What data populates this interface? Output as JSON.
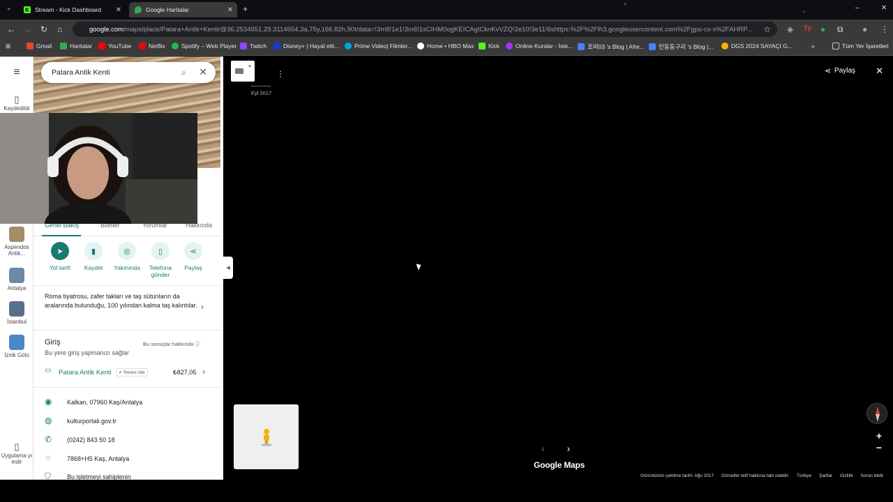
{
  "browser": {
    "tabs": [
      {
        "label": "Stream - Kick Dashboard",
        "icon": "kick-icon",
        "active": false
      },
      {
        "label": "Google Haritalar",
        "icon": "maps-pin-icon",
        "active": true
      }
    ],
    "url_host": "google.com",
    "url_rest": "/maps/place/Patara+Antik+Kenti/@36.2534651,29.3114654,3a,75y,166.82h,90t/data=!3m8!1e1!3m6!1sCIHM0ogKEICAgICknKvVZQ!2e10!3e11!6shttps:%2F%2Flh3.googleusercontent.com%2Fgps-cs-s%2FAHRP...",
    "bookmarks": [
      {
        "label": "Gmail",
        "color": "#ea4335"
      },
      {
        "label": "Haritalar",
        "color": "#34a853"
      },
      {
        "label": "YouTube",
        "color": "#ff0000"
      },
      {
        "label": "Netflix",
        "color": "#e50914"
      },
      {
        "label": "Spotify – Web Player",
        "color": "#1db954"
      },
      {
        "label": "Twitch",
        "color": "#9146ff"
      },
      {
        "label": "Disney+ | Hayal etti...",
        "color": "#113ccf"
      },
      {
        "label": "Prime Video| Filmler...",
        "color": "#00a8e1"
      },
      {
        "label": "Home • HBO Max",
        "color": "#ffffff"
      },
      {
        "label": "Kick",
        "color": "#53fc18"
      },
      {
        "label": "Online Kurslar - İste...",
        "color": "#a435f0"
      },
      {
        "label": "조비03 's Blog | Afre...",
        "color": "#4e7cff"
      },
      {
        "label": "민동동구리 's Blog |...",
        "color": "#4e7cff"
      },
      {
        "label": "DGS 2024 SAYAÇI G...",
        "color": "#f4b400"
      }
    ],
    "bookmarks_overflow": "»",
    "all_bookmarks": "Tüm Yer İşaretleri"
  },
  "rail": {
    "saved": "Kaydedildi",
    "recents": [
      {
        "label": "Aspendos Antik...",
        "color": "#a58d6a"
      },
      {
        "label": "Antalya",
        "color": "#6b8aa8"
      },
      {
        "label": "İstanbul",
        "color": "#5a6f8c"
      },
      {
        "label": "İznik Gölü",
        "color": "#4d86c6"
      }
    ],
    "app_download": "Uygulama yı indir"
  },
  "panel": {
    "search_value": "Patara Antik Kenti",
    "tabs": [
      "Genel Bakış",
      "Biletler",
      "Yorumlar",
      "Hakkında"
    ],
    "actions": [
      {
        "label": "Yol tarifi",
        "icon": "directions-icon"
      },
      {
        "label": "Kaydet",
        "icon": "bookmark-icon"
      },
      {
        "label": "Yakınında",
        "icon": "nearby-icon"
      },
      {
        "label": "Telefona gönder",
        "icon": "send-to-phone-icon"
      },
      {
        "label": "Paylaş",
        "icon": "share-icon"
      }
    ],
    "description": "Roma tiyatrosu, zafer takları ve taş sütunların da aralarında bulunduğu, 100 yılından kalma taş kalıntılar.",
    "entry_title": "Giriş",
    "entry_subtitle": "Bu yere giriş yapmanızı sağlar",
    "results_note": "Bu sonuçlar hakkında",
    "ticket_name": "Patara Antik Kenti",
    "ticket_badge": "Resmi site",
    "ticket_price": "₺827,05",
    "address": "Kalkan, 07960 Kaş/Antalya",
    "website": "kulturportali.gov.tr",
    "phone": "(0242) 843 50 18",
    "plus_code": "7868+H5 Kaş, Antalya",
    "claim": "Bu işletmeyi sahiplenin"
  },
  "viewer": {
    "date_label": "Eyl 2017",
    "share_label": "Paylaş",
    "brand": "Google Maps",
    "footer": [
      "Görüntünün çekilme tarihi: Ağu 2017",
      "Görseller telif hakkına tabi olabilir.",
      "Türkiye",
      "Şartlar",
      "Gizlilik",
      "Sorun bildir"
    ]
  }
}
